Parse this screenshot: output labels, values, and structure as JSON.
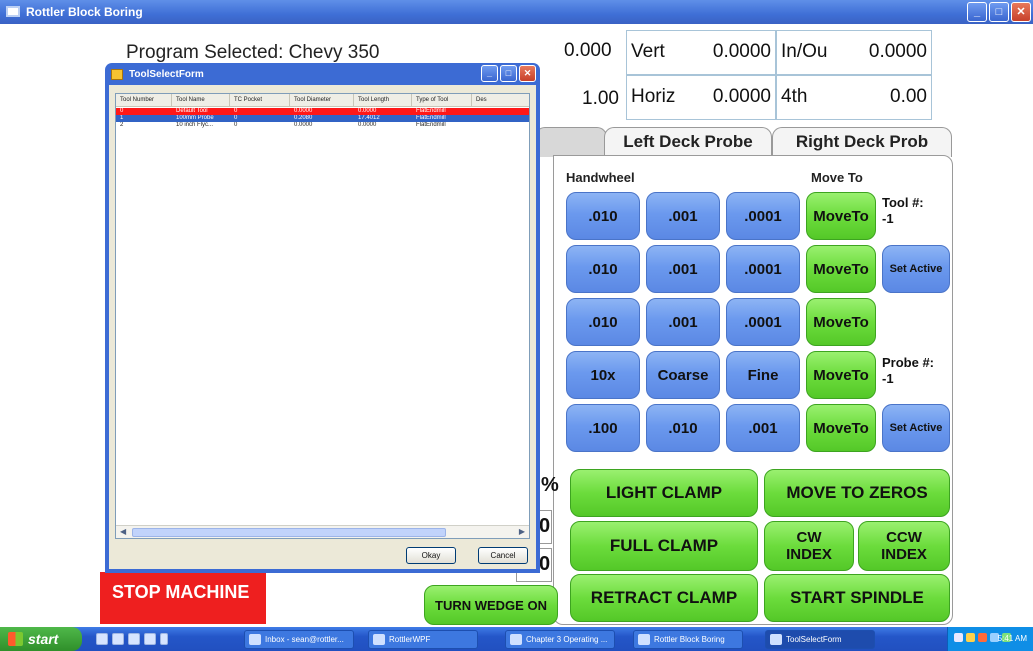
{
  "app": {
    "title": "Rottler Block Boring"
  },
  "program": {
    "selected_label": "Program Selected: Chevy 350"
  },
  "readouts": [
    {
      "value": "0.000",
      "label": "Vert",
      "label_value": "0.0000",
      "label2": "In/Ou",
      "value2": "0.0000"
    },
    {
      "value": "1.00",
      "label": "Horiz",
      "label_value": "0.0000",
      "label2": "4th",
      "value2": "0.00"
    }
  ],
  "tabs": {
    "left_deck_probe": "Left Deck Probe",
    "right_deck_probe": "Right Deck Prob"
  },
  "panel": {
    "handwheel_header": "Handwheel",
    "move_to_header": "Move To",
    "tool_label": "Tool #:",
    "tool_value": "-1",
    "probe_label": "Probe #:",
    "probe_value": "-1",
    "set_active_1": "Set Active",
    "set_active_2": "Set Active",
    "rows": [
      [
        ".010",
        ".001",
        ".0001",
        "MoveTo"
      ],
      [
        ".010",
        ".001",
        ".0001",
        "MoveTo"
      ],
      [
        ".010",
        ".001",
        ".0001",
        "MoveTo"
      ],
      [
        "10x",
        "Coarse",
        "Fine",
        "MoveTo"
      ],
      [
        ".100",
        ".010",
        ".001",
        "MoveTo"
      ]
    ],
    "light_clamp": "LIGHT CLAMP",
    "move_to_zeros": "MOVE TO ZEROS",
    "full_clamp": "FULL CLAMP",
    "cw_index": "CW INDEX",
    "ccw_index": "CCW INDEX",
    "retract_clamp": "RETRACT CLAMP",
    "start_spindle": "START SPINDLE"
  },
  "bottom": {
    "stop_machine": "STOP MACHINE",
    "turn_wedge_on": "TURN WEDGE ON",
    "frag_pct": "%",
    "frag_a": "0",
    "frag_b": "0"
  },
  "dialog": {
    "title": "ToolSelectForm",
    "columns": [
      "Tool Number",
      "Tool Name",
      "TC Pocket",
      "Tool Diameter",
      "Tool Length",
      "Type of Tool",
      "Des"
    ],
    "rows": [
      [
        "0",
        "Default Tool",
        "0",
        "0.0000",
        "0.0000",
        "FlatEndmill"
      ],
      [
        "1",
        "100mm Probe",
        "0",
        "0.2080",
        "17.4012",
        "FlatEndmill"
      ],
      [
        "2",
        "10 inch Flyc...",
        "0",
        "0.0000",
        "0.0000",
        "FlatEndmill"
      ]
    ],
    "okay": "Okay",
    "cancel": "Cancel"
  },
  "taskbar": {
    "start": "start",
    "tasks": [
      "Inbox - sean@rottler...",
      "RottlerWPF",
      "Chapter 3 Operating ...",
      "Rottler Block Boring",
      "ToolSelectForm"
    ],
    "time": "5:41 AM"
  },
  "colors": {
    "blue_button": "#6b99ee",
    "green_button": "#6cdc3c",
    "stop_red": "#ee1f1f",
    "titlebar": "#3f6fd6"
  }
}
